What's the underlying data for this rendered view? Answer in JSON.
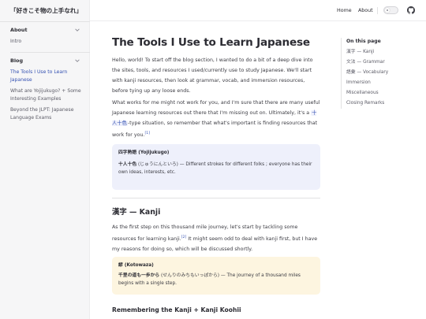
{
  "site": {
    "title": "「好きこそ物の上手なれ」"
  },
  "nav": {
    "home": "Home",
    "about": "About"
  },
  "sidebar": {
    "groups": [
      {
        "label": "About",
        "items": [
          {
            "label": "Intro"
          }
        ]
      },
      {
        "label": "Blog",
        "items": [
          {
            "label": "The Tools I Use to Learn Japanese",
            "active": true
          },
          {
            "label": "What are Yojijukugo? + Some Interesting Examples"
          },
          {
            "label": "Beyond the JLPT: Japanese Language Exams"
          }
        ]
      }
    ]
  },
  "article": {
    "title": "The Tools I Use to Learn Japanese",
    "p1": "Hello, world! To start off the blog section, I wanted to do a bit of a deep dive into the sites, tools, and resources I used/currently use to study Japanese. We'll start with kanji resources, then look at grammar, vocab, and immersion resources, before tying up any loose ends.",
    "p2_before": "What works for me might not work for you, and I'm sure that there are many useful Japanese learning resources out there that I'm missing out on. Ultimately, it's a ",
    "p2_keyword": "十人十色",
    "p2_after": "-type situation, so remember that what's important is finding resources that work for you.",
    "p2_footnote": "[1]",
    "callout1": {
      "title": "四字熟語 (Yojijukugo)",
      "term": "十人十色",
      "reading": " (じゅうにんといろ) — Different strokes for different folks ; everyone has their own ideas, interests, etc."
    },
    "h2_kanji": "漢字 — Kanji",
    "p3_before": "As the first step on this thousand mile journey, let's start by tackling some resources for learning kanji.",
    "p3_footnote": "[2]",
    "p3_after": " It might seem odd to deal with kanji first, but I have my reasons for doing so, which will be discussed shortly.",
    "callout2": {
      "title": "諺 (Kotowaza)",
      "term": "千里の道も一歩から",
      "reading": " (せんりのみちもいっぽから) — The journey of a thousand miles begins with a single step."
    },
    "h3_remembering": "Remembering the Kanji + Kanji Koohii"
  },
  "outline": {
    "title": "On this page",
    "items": [
      "漢字 — Kanji",
      "文法 — Grammar",
      "語彙 — Vocabulary",
      "Immersion",
      "Miscellaneous",
      "Closing Remarks"
    ]
  },
  "colors": {
    "accent": "#3451b2",
    "callout_blue": "#eef0fb",
    "callout_yellow": "#fdf5e0"
  }
}
